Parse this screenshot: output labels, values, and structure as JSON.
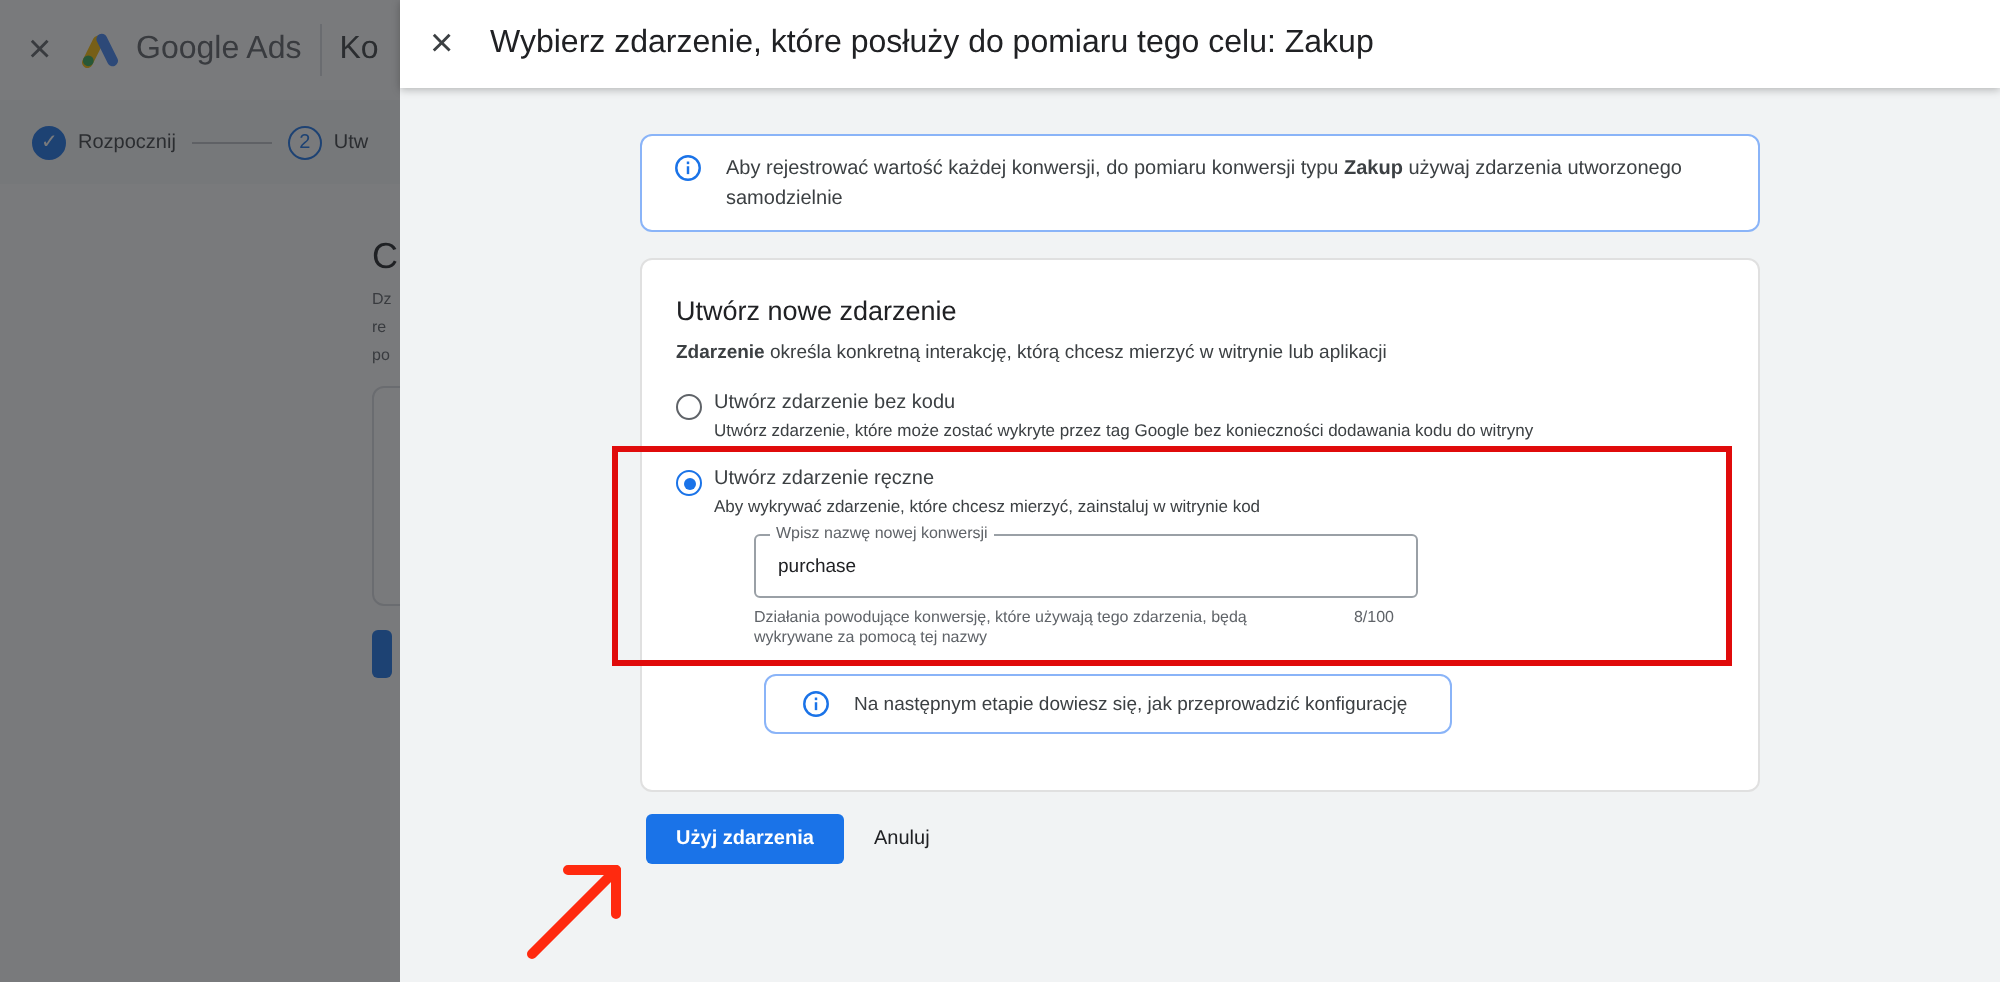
{
  "background_page": {
    "close": "×",
    "product": "Google Ads",
    "title": "Ko",
    "steps": [
      {
        "marker": "✓",
        "label": "Rozpocznij",
        "done": true
      },
      {
        "marker": "2",
        "label": "Utw",
        "done": false
      }
    ],
    "heading": "C",
    "lines": [
      "Dz",
      "re",
      "po"
    ]
  },
  "dialog": {
    "close": "×",
    "title": "Wybierz zdarzenie, które posłuży do pomiaru tego celu: Zakup"
  },
  "info_banner": "Aby rejestrować wartość każdej konwersji, do pomiaru konwersji typu **Zakup** używaj zdarzenia utworzonego samodzielnie",
  "card": {
    "title": "Utwórz nowe zdarzenie",
    "description": "**Zdarzenie** określa konkretną interakcję, którą chcesz mierzyć w witrynie lub aplikacji",
    "options": [
      {
        "label": "Utwórz zdarzenie bez kodu",
        "description": "Utwórz zdarzenie, które może zostać wykryte przez tag Google bez konieczności dodawania kodu do witryny",
        "selected": false
      },
      {
        "label": "Utwórz zdarzenie ręczne",
        "description": "Aby wykrywać zdarzenie, które chcesz mierzyć, zainstaluj w witrynie kod",
        "selected": true,
        "highlighted": true,
        "field": {
          "label": "Wpisz nazwę nowej konwersji",
          "value": "purchase",
          "helper": "Działania powodujące konwersję, które używają tego zdarzenia, będą wykrywane za pomocą tej nazwy",
          "counter": "8/100"
        },
        "note": "Na następnym etapie dowiesz się, jak przeprowadzić konfigurację"
      }
    ]
  },
  "buttons": [
    {
      "label": "Użyj zdarzenia",
      "kind": "primary"
    },
    {
      "label": "Anuluj",
      "kind": "text"
    }
  ],
  "annotations": [
    {
      "kind": "arrow"
    }
  ]
}
